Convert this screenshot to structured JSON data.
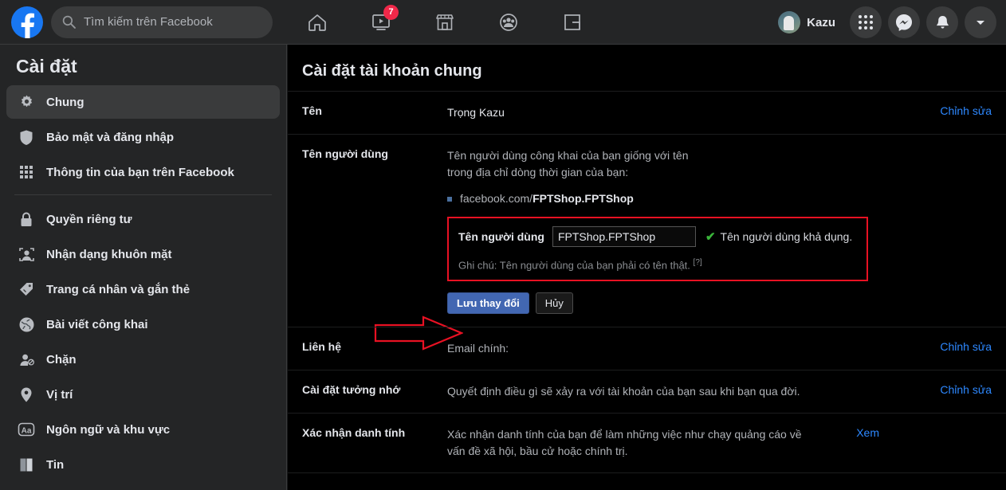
{
  "header": {
    "logo_icon": "facebook-logo-icon",
    "search": {
      "placeholder": "Tìm kiếm trên Facebook",
      "value": "",
      "icon": "search-icon"
    },
    "nav": [
      {
        "name": "home",
        "icon": "home-icon",
        "badge": ""
      },
      {
        "name": "watch",
        "icon": "watch-video-icon",
        "badge": "7"
      },
      {
        "name": "marketplace",
        "icon": "marketplace-store-icon",
        "badge": ""
      },
      {
        "name": "groups",
        "icon": "groups-people-icon",
        "badge": ""
      },
      {
        "name": "gaming",
        "icon": "gaming-icon",
        "badge": ""
      }
    ],
    "profile_name": "Kazu",
    "avatar_icon": "user-avatar",
    "menu_icon": "apps-grid-icon",
    "messenger_icon": "messenger-icon",
    "notifications_icon": "bell-icon",
    "account_icon": "chevron-down-icon"
  },
  "sidebar": {
    "title": "Cài đặt",
    "items": [
      {
        "label": "Chung",
        "icon": "gear-icon",
        "active": true
      },
      {
        "label": "Bảo mật và đăng nhập",
        "icon": "shield-icon",
        "active": false
      },
      {
        "label": "Thông tin của bạn trên Facebook",
        "icon": "grid-dots-icon",
        "active": false
      },
      {
        "label": "Quyền riêng tư",
        "icon": "lock-icon",
        "active": false
      },
      {
        "label": "Nhận dạng khuôn mặt",
        "icon": "face-recognition-icon",
        "active": false
      },
      {
        "label": "Trang cá nhân và gắn thẻ",
        "icon": "tag-icon",
        "active": false
      },
      {
        "label": "Bài viết công khai",
        "icon": "globe-icon",
        "active": false
      },
      {
        "label": "Chặn",
        "icon": "block-user-icon",
        "active": false
      },
      {
        "label": "Vị trí",
        "icon": "location-pin-icon",
        "active": false
      },
      {
        "label": "Ngôn ngữ và khu vực",
        "icon": "language-aa-icon",
        "active": false
      },
      {
        "label": "Tin",
        "icon": "stories-book-icon",
        "active": false
      }
    ]
  },
  "main": {
    "title": "Cài đặt tài khoản chung",
    "rows": {
      "name": {
        "label": "Tên",
        "value": "Trọng Kazu",
        "action": "Chỉnh sửa"
      },
      "username": {
        "label": "Tên người dùng",
        "description": "Tên người dùng công khai của bạn giống với tên trong địa chỉ dòng thời gian của bạn:",
        "url_prefix": "facebook.com/",
        "url_handle": "FPTShop.FPTShop",
        "edit": {
          "field_label": "Tên người dùng",
          "input_value": "FPTShop.FPTShop",
          "input_placeholder": "Tên người dùng",
          "check_icon": "green-check-icon",
          "availability": "Tên người dùng khả dụng.",
          "note": "Ghi chú: Tên người dùng của bạn phải có tên thật.",
          "note_help": "[?]"
        },
        "save_label": "Lưu thay đổi",
        "cancel_label": "Hủy",
        "annotation_icon": "red-arrow-annotation"
      },
      "contact": {
        "label": "Liên hệ",
        "value": "Email chính:",
        "action": "Chỉnh sửa"
      },
      "memorial": {
        "label": "Cài đặt tưởng nhớ",
        "value": "Quyết định điều gì sẽ xảy ra với tài khoản của bạn sau khi bạn qua đời.",
        "action": "Chỉnh sửa"
      },
      "identity": {
        "label": "Xác nhận danh tính",
        "value": "Xác nhận danh tính của bạn để làm những việc như chạy quảng cáo về vấn đề xã hội, bầu cử hoặc chính trị.",
        "action": "Xem"
      }
    }
  },
  "colors": {
    "brand_blue": "#1877f2",
    "link_blue": "#2d88ff",
    "button_blue": "#4267b2",
    "badge_red": "#f02849",
    "annotation_red": "#e81123",
    "success_green": "#3ab53a",
    "panel_dark": "#242526",
    "content_black": "#000000"
  }
}
